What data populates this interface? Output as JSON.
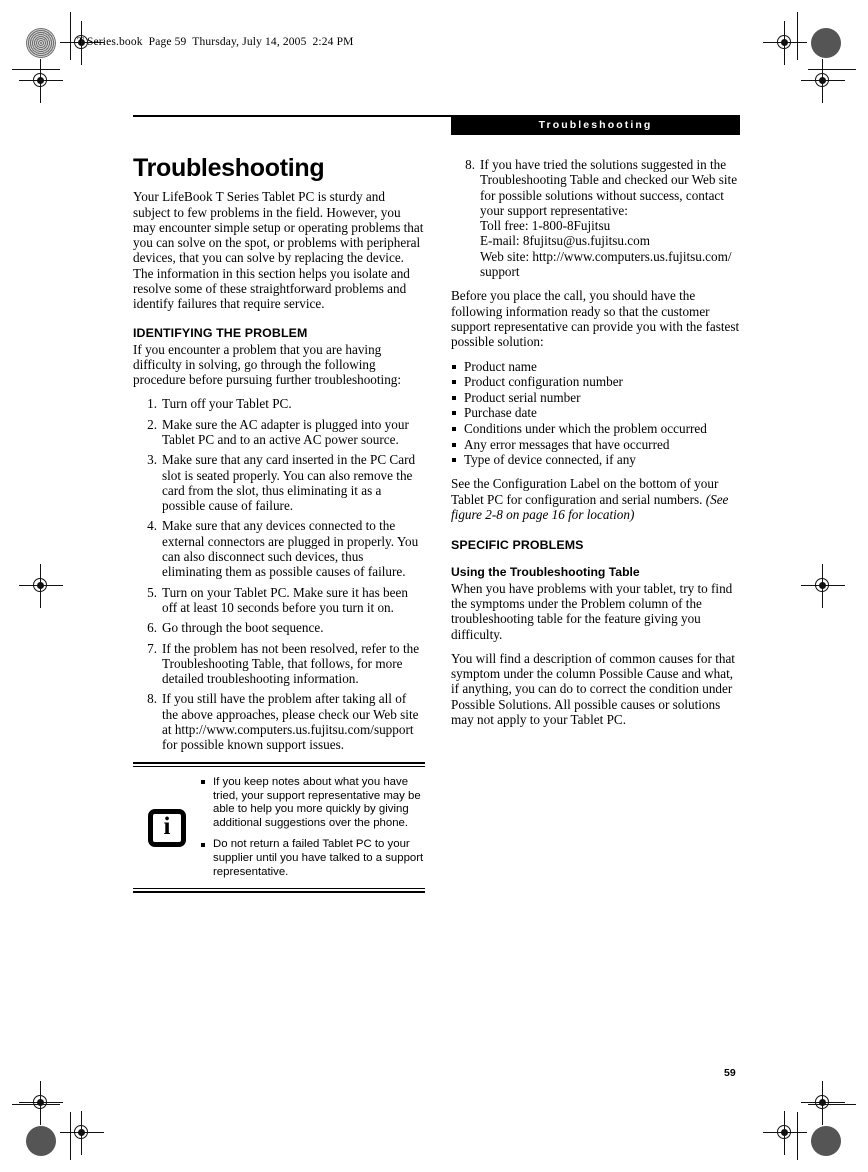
{
  "book_header": "T Series.book  Page 59  Thursday, July 14, 2005  2:24 PM",
  "running_head": "Troubleshooting",
  "folio": "59",
  "left_column": {
    "title": "Troubleshooting",
    "intro": "Your LifeBook T Series Tablet PC is sturdy and subject to few problems in the field. However, you may encounter simple setup or operating problems that you can solve on the spot, or problems with peripheral devices, that you can solve by replacing the device. The information in this section helps you isolate and resolve some of these straightforward problems and identify failures that require service.",
    "section_heading": "IDENTIFYING THE PROBLEM",
    "section_intro": "If you encounter a problem that you are having difficulty in solving, go through the following procedure before pursuing further troubleshooting:",
    "steps": [
      {
        "num": "1.",
        "text": "Turn off your Tablet PC."
      },
      {
        "num": "2.",
        "text": "Make sure the AC adapter is plugged into your Tablet PC and to an active AC power source."
      },
      {
        "num": "3.",
        "text": "Make sure that any card inserted in the PC Card slot is seated properly. You can also remove the card from the slot, thus eliminating it as a possible cause of failure."
      },
      {
        "num": "4.",
        "text": "Make sure that any devices connected to the external connectors are plugged in properly. You can also disconnect such devices, thus eliminating them as possible causes of failure."
      },
      {
        "num": "5.",
        "text": "Turn on your Tablet PC. Make sure it has been off at least 10 seconds before you turn it on."
      },
      {
        "num": "6.",
        "text": "Go through the boot sequence."
      },
      {
        "num": "7.",
        "text": "If the problem has not been resolved, refer to the Troubleshooting Table, that follows, for more detailed troubleshooting information."
      },
      {
        "num": "8.",
        "text": "If you still have the problem after taking all of the above approaches, please check our Web site at http://www.computers.us.fujitsu.com/support for possible known support issues."
      }
    ]
  },
  "note_box": {
    "icon": "info-icon",
    "items": [
      "If you keep notes about what you have tried, your support representative may be able to help you more quickly by giving additional suggestions over the phone.",
      "Do not return a failed Tablet PC to your supplier until you have talked to a support representative."
    ]
  },
  "right_column": {
    "step8": {
      "num": "8.",
      "text": "If you have tried the solutions suggested in the Troubleshooting Table and checked our Web site for possible solutions without success, contact your support representative:",
      "contact": [
        "Toll free: 1-800-8Fujitsu",
        "E-mail: 8fujitsu@us.fujitsu.com",
        "Web site: http://www.computers.us.fujitsu.com/ support"
      ]
    },
    "before_call": "Before you place the call, you should have the following information ready so that the customer support representative can provide you with the fastest possible solution:",
    "info_items": [
      "Product name",
      "Product configuration number",
      "Product serial number",
      "Purchase date",
      "Conditions under which the problem occurred",
      "Any error messages that have occurred",
      "Type of device connected, if any"
    ],
    "config_label_text": "See the Configuration Label on the bottom of your Tablet PC for configuration and serial numbers. ",
    "config_label_italic": "(See figure 2-8 on page 16 for location)",
    "specific_problems_heading": "SPECIFIC PROBLEMS",
    "using_table_heading": "Using the Troubleshooting Table",
    "using_table_body": "When you have problems with your tablet, try to find the symptoms under the Problem column of the troubleshooting table for the feature giving you difficulty.",
    "description_body": "You will find a description of common causes for that symptom under the column Possible Cause and what, if anything, you can do to correct the condition under Possible Solutions. All possible causes or solutions may not apply to your Tablet PC."
  }
}
